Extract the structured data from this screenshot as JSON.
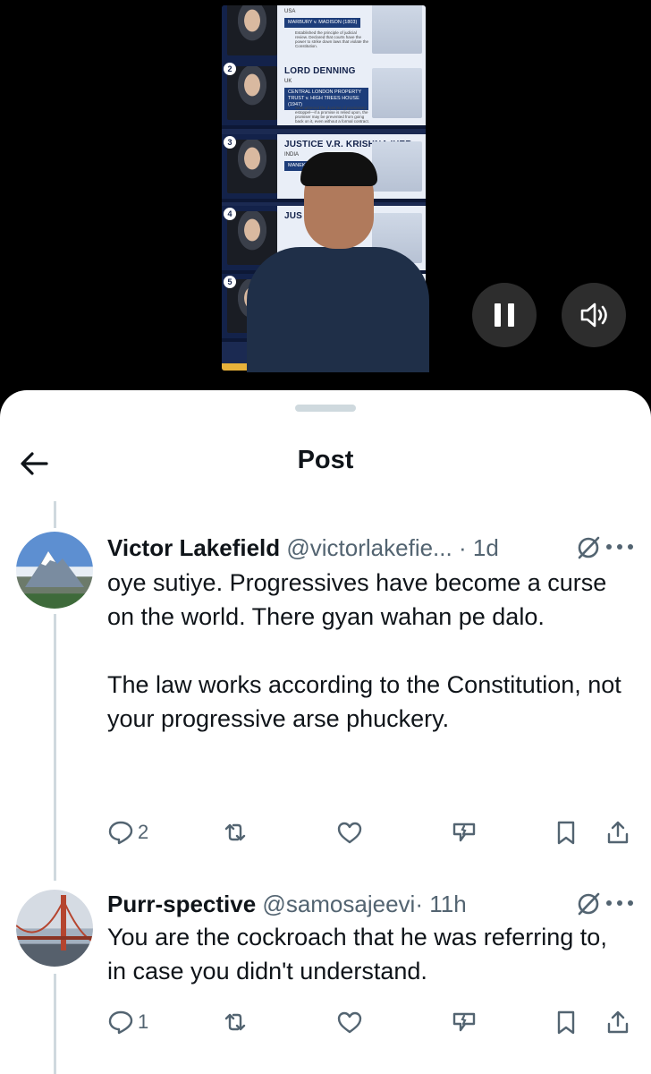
{
  "video": {
    "cards": [
      {
        "number": "",
        "name": "MARBURY v. MADISON (1803)",
        "country": "USA",
        "case": "",
        "desc": "Established the principle of judicial review. Declared that courts have the power to strike down laws that violate the Constitution."
      },
      {
        "number": "2",
        "name": "LORD DENNING",
        "country": "UK",
        "case": "CENTRAL LONDON PROPERTY TRUST v. HIGH TREES HOUSE (1947)",
        "desc": "Strengthened the doctrine of promissory estoppel—if a promise is relied upon, the promiser may be prevented from going back on it, even without a formal contract."
      },
      {
        "number": "3",
        "name": "JUSTICE V.R. KRISHNA IYER",
        "country": "INDIA",
        "case": "MANEKA",
        "desc": ""
      },
      {
        "number": "4",
        "name": "JUS",
        "country": "",
        "case": "",
        "desc": ""
      },
      {
        "number": "5",
        "name": "",
        "country": "",
        "case": "",
        "desc": ""
      }
    ],
    "pause_label": "Pause",
    "volume_label": "Volume"
  },
  "sheet": {
    "title": "Post"
  },
  "replies": [
    {
      "display_name": "Victor Lakefield",
      "handle": "@victorlakefie...",
      "dot": "·",
      "time": "1d",
      "paragraphs": [
        "oye sutiye. Progressives have become a curse on the world. There gyan wahan pe dalo.",
        "The law works according to the Constitution, not your progressive arse phuckery."
      ],
      "reply_count": "2"
    },
    {
      "display_name": "Purr-spective",
      "handle": "@samosajeevi",
      "dot": "·",
      "time": "11h",
      "paragraphs": [
        "You are the cockroach that he was referring to, in case you didn't understand."
      ],
      "reply_count": "1"
    }
  ],
  "colors": {
    "text": "#0f1419",
    "secondary": "#536471",
    "thread_line": "#cfd9de",
    "background": "#ffffff"
  }
}
